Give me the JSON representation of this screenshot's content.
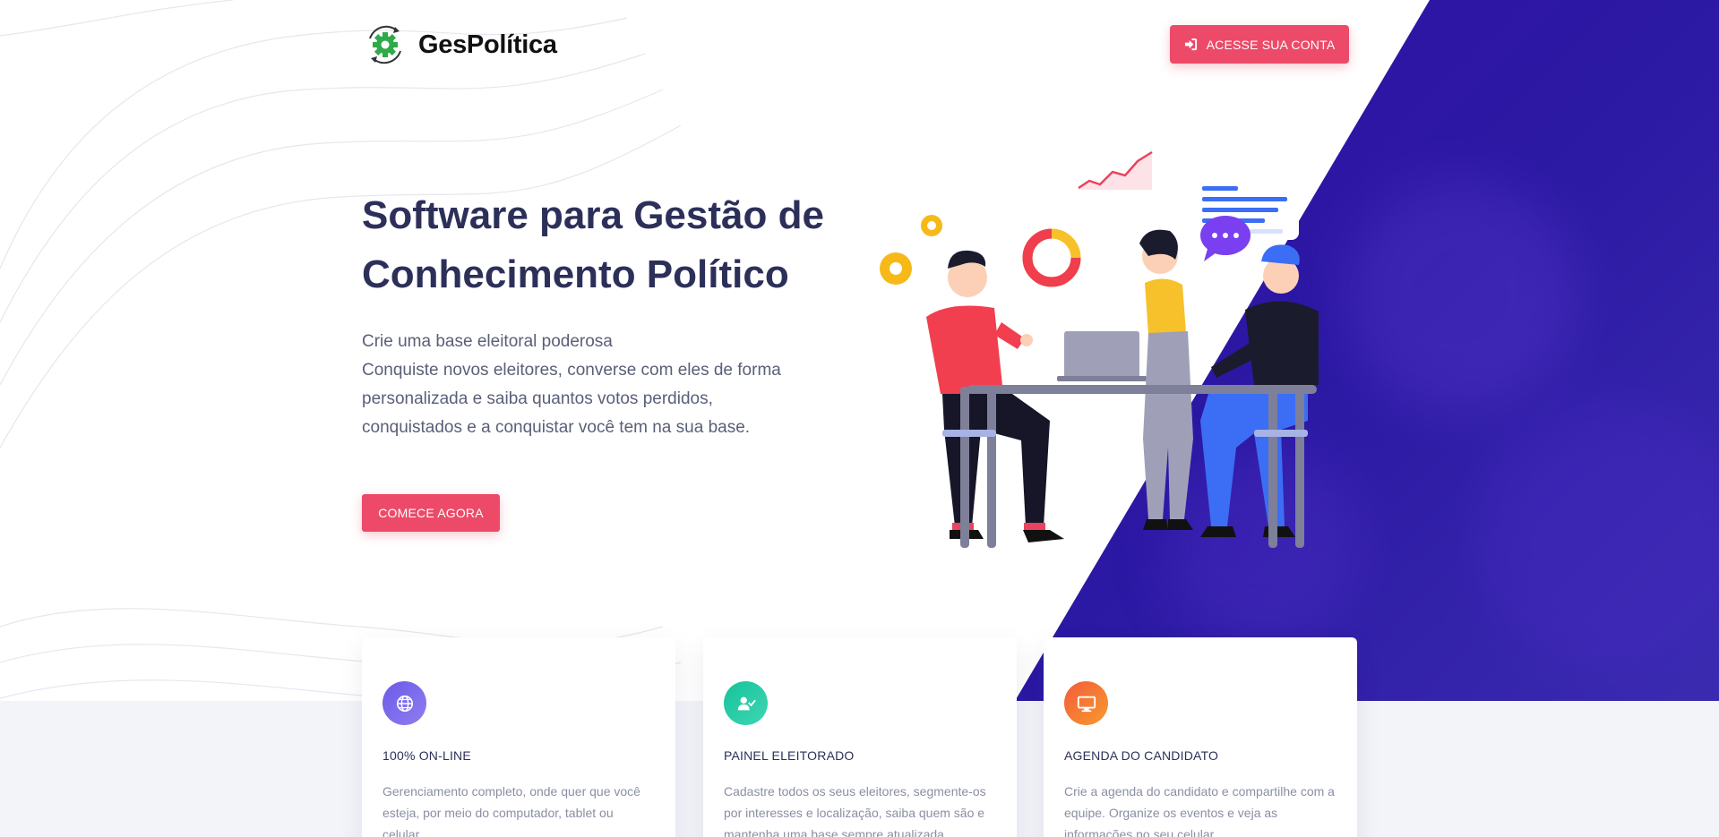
{
  "header": {
    "brand": "GesPolítica",
    "login_label": "ACESSE SUA CONTA"
  },
  "hero": {
    "title_line1": "Software para Gestão de",
    "title_line2": "Conhecimento Político",
    "subtitle_lines": [
      "Crie uma base eleitoral poderosa",
      "Conquiste novos eleitores, converse com eles de forma",
      "personalizada e saiba quantos votos perdidos,",
      "conquistados e a conquistar você tem na sua base."
    ],
    "cta_label": "COMECE AGORA"
  },
  "features": [
    {
      "icon": "globe-icon",
      "color": "#6c5ce7",
      "title": "100% ON-LINE",
      "text": "Gerenciamento completo, onde quer que você esteja, por meio do computador, tablet ou celular."
    },
    {
      "icon": "user-check-icon",
      "color": "#1fc8a0",
      "title": "PAINEL ELEITORADO",
      "text": "Cadastre todos os seus eleitores, segmente-os por interesses e localização, saiba quem são e mantenha uma base sempre atualizada."
    },
    {
      "icon": "monitor-icon",
      "color": "#f7782e",
      "title": "AGENDA DO CANDIDATO",
      "text": "Crie a agenda do candidato e compartilhe com a equipe. Organize os eventos e veja as informações no seu celular."
    }
  ],
  "colors": {
    "accent": "#ec4a68",
    "heading": "#2c3059",
    "purple": "#3412a6"
  }
}
